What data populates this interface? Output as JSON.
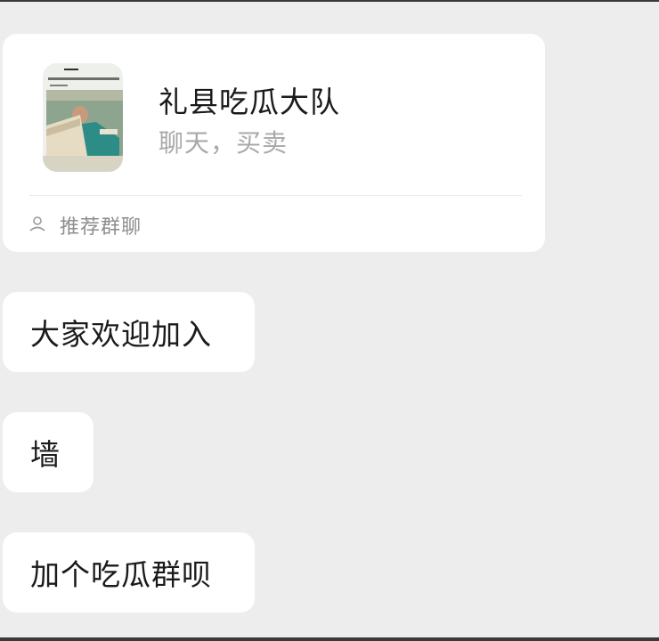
{
  "shared_group_card": {
    "name": "礼县吃瓜大队",
    "description": "聊天，买卖",
    "footer_label": "推荐群聊",
    "footer_icon": "person-icon",
    "avatar_icon": "group-avatar-photo"
  },
  "messages": [
    {
      "text": "大家欢迎加入"
    },
    {
      "text": "墙"
    },
    {
      "text": "加个吃瓜群呗"
    }
  ],
  "colors": {
    "background": "#ededed",
    "bubble": "#ffffff",
    "primary_text": "#1b1b1b",
    "secondary_text": "#a8a8a8",
    "footer_text": "#8e8e8e"
  }
}
